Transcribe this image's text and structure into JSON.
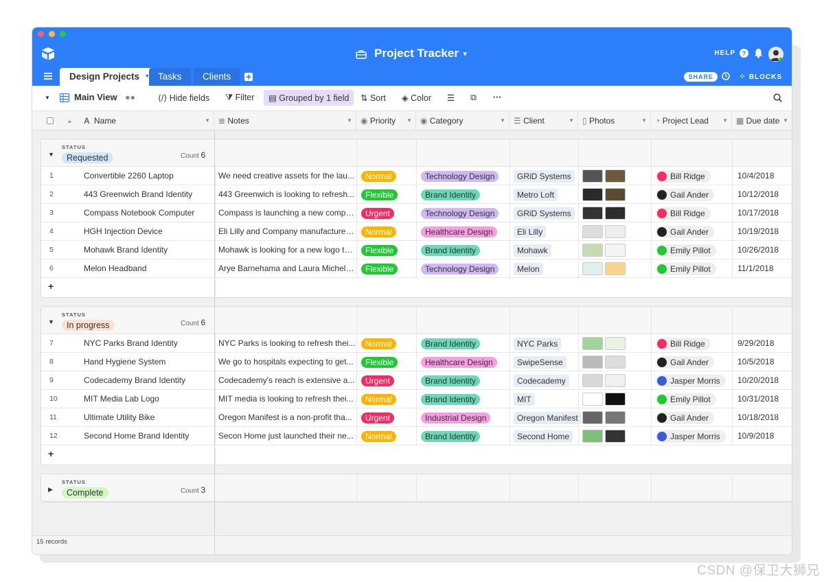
{
  "app": {
    "title": "Project Tracker",
    "help_label": "HELP",
    "share_label": "SHARE",
    "blocks_label": "BLOCKS"
  },
  "tabs": [
    {
      "label": "Design Projects"
    },
    {
      "label": "Tasks"
    },
    {
      "label": "Clients"
    }
  ],
  "toolbar": {
    "view_name": "Main View",
    "hide_fields": "Hide fields",
    "filter": "Filter",
    "grouped": "Grouped by 1 field",
    "sort": "Sort",
    "color": "Color"
  },
  "columns": [
    "Name",
    "Notes",
    "Priority",
    "Category",
    "Client",
    "Photos",
    "Project Lead",
    "Due date"
  ],
  "groups": [
    {
      "status_label": "STATUS",
      "status": "Requested",
      "count_label": "Count",
      "count": "6",
      "rows": [
        {
          "n": "1",
          "name": "Convertible 2260 Laptop",
          "notes": "We need creative assets for the lau...",
          "priority": "Normal",
          "category": "Technology Design",
          "client": "GRiD Systems",
          "lead": "Bill Ridge",
          "due": "10/4/2018"
        },
        {
          "n": "2",
          "name": "443 Greenwich Brand Identity",
          "notes": "443 Greenwich is looking to refresh...",
          "priority": "Flexible",
          "category": "Brand Identity",
          "client": "Metro Loft",
          "lead": "Gail Ander",
          "due": "10/12/2018"
        },
        {
          "n": "3",
          "name": "Compass Notebook Computer",
          "notes": "Compass is launching a new compu...",
          "priority": "Urgent",
          "category": "Technology Design",
          "client": "GRiD Systems",
          "lead": "Bill Ridge",
          "due": "10/17/2018"
        },
        {
          "n": "4",
          "name": "HGH Injection Device",
          "notes": "Eli Lilly and Company manufactures...",
          "priority": "Normal",
          "category": "Healthcare Design",
          "client": "Eli Lilly",
          "lead": "Gail Ander",
          "due": "10/19/2018"
        },
        {
          "n": "5",
          "name": "Mohawk Brand Identity",
          "notes": "Mohawk is looking for a new logo th...",
          "priority": "Flexible",
          "category": "Brand Identity",
          "client": "Mohawk",
          "lead": "Emily Pillot",
          "due": "10/26/2018"
        },
        {
          "n": "6",
          "name": "Melon Headband",
          "notes": "Arye Barnehama and Laura Michelle...",
          "priority": "Flexible",
          "category": "Technology Design",
          "client": "Melon",
          "lead": "Emily Pillot",
          "due": "11/1/2018"
        }
      ]
    },
    {
      "status_label": "STATUS",
      "status": "In progress",
      "count_label": "Count",
      "count": "6",
      "rows": [
        {
          "n": "7",
          "name": "NYC Parks Brand Identity",
          "notes": "NYC Parks is looking to refresh thei...",
          "priority": "Normal",
          "category": "Brand Identity",
          "client": "NYC Parks",
          "lead": "Bill Ridge",
          "due": "9/29/2018"
        },
        {
          "n": "8",
          "name": "Hand Hygiene System",
          "notes": "We go to hospitals expecting to get...",
          "priority": "Flexible",
          "category": "Healthcare Design",
          "client": "SwipeSense",
          "lead": "Gail Ander",
          "due": "10/5/2018"
        },
        {
          "n": "9",
          "name": "Codecademy Brand Identity",
          "notes": "Codecademy's reach is extensive a...",
          "priority": "Urgent",
          "category": "Brand Identity",
          "client": "Codecademy",
          "lead": "Jasper Morris",
          "due": "10/20/2018"
        },
        {
          "n": "10",
          "name": "MIT Media Lab Logo",
          "notes": "MIT media is looking to refresh thei...",
          "priority": "Normal",
          "category": "Brand Identity",
          "client": "MIT",
          "lead": "Emily Pillot",
          "due": "10/31/2018"
        },
        {
          "n": "11",
          "name": "Ultimate Utility Bike",
          "notes": "Oregon Manifest is a non-profit tha...",
          "priority": "Urgent",
          "category": "Industrial Design",
          "client": "Oregon Manifest",
          "lead": "Gail Ander",
          "due": "10/18/2018"
        },
        {
          "n": "12",
          "name": "Second Home Brand Identity",
          "notes": "Secon Home just launched their ne...",
          "priority": "Normal",
          "category": "Brand Identity",
          "client": "Second Home",
          "lead": "Jasper Morris",
          "due": "10/9/2018"
        }
      ]
    },
    {
      "status_label": "STATUS",
      "status": "Complete",
      "count_label": "Count",
      "count": "3",
      "rows": []
    }
  ],
  "add_row_glyph": "+",
  "footer": {
    "records": "15 records"
  },
  "watermark": "CSDN @保卫大狮兄",
  "colors": {
    "topbar": "#2d7ff9",
    "normal": "#fcb400",
    "flexible": "#20c933",
    "urgent": "#f82b60",
    "tech": "#d0b8f5",
    "brand": "#6ad9b8",
    "health": "#f99de2",
    "requested": "#cfe6fb",
    "in_progress": "#fde0d5",
    "complete": "#d1f7c4"
  }
}
